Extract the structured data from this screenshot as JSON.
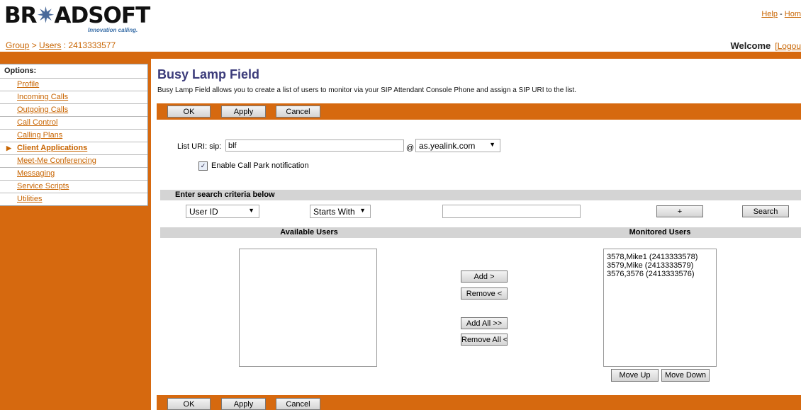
{
  "brand": {
    "name": "BROADSOFT",
    "tagline": "Innovation calling."
  },
  "header": {
    "links": [
      "Help",
      "Hom"
    ],
    "separator": " - ",
    "breadcrumb": {
      "group": "Group",
      "sep": " > ",
      "users": "Users",
      "suffix": " : 2413333577"
    },
    "welcome": "Welcome",
    "logout": "[Logou"
  },
  "sidebar": {
    "title": "Options:",
    "items": [
      {
        "label": "Profile"
      },
      {
        "label": "Incoming Calls"
      },
      {
        "label": "Outgoing Calls"
      },
      {
        "label": "Call Control"
      },
      {
        "label": "Calling Plans"
      },
      {
        "label": "Client Applications",
        "active": true
      },
      {
        "label": "Meet-Me Conferencing"
      },
      {
        "label": "Messaging"
      },
      {
        "label": "Service Scripts"
      },
      {
        "label": "Utilities"
      }
    ]
  },
  "page": {
    "title": "Busy Lamp Field",
    "description": "Busy Lamp Field allows you to create a list of users to monitor via your SIP Attendant Console Phone and assign a SIP URI to the list."
  },
  "buttons": {
    "ok": "OK",
    "apply": "Apply",
    "cancel": "Cancel"
  },
  "form": {
    "list_uri_label": "List URI: sip:",
    "list_uri_value": "blf",
    "at": "@",
    "domain": "as.yealink.com",
    "call_park_label": "Enable Call Park notification",
    "call_park_checked": true
  },
  "search": {
    "header": "Enter search criteria below",
    "field": "User ID",
    "mode": "Starts With",
    "value": "",
    "plus_label": "+",
    "search_label": "Search"
  },
  "users": {
    "available_header": "Available Users",
    "monitored_header": "Monitored Users",
    "available": [],
    "monitored": [
      "3578,Mike1 (2413333578)",
      "3579,Mike (2413333579)",
      "3576,3576 (2413333576)"
    ],
    "add": "Add >",
    "remove": "Remove <",
    "add_all": "Add All >>",
    "remove_all": "Remove All <",
    "move_up": "Move Up",
    "move_down": "Move Down"
  }
}
